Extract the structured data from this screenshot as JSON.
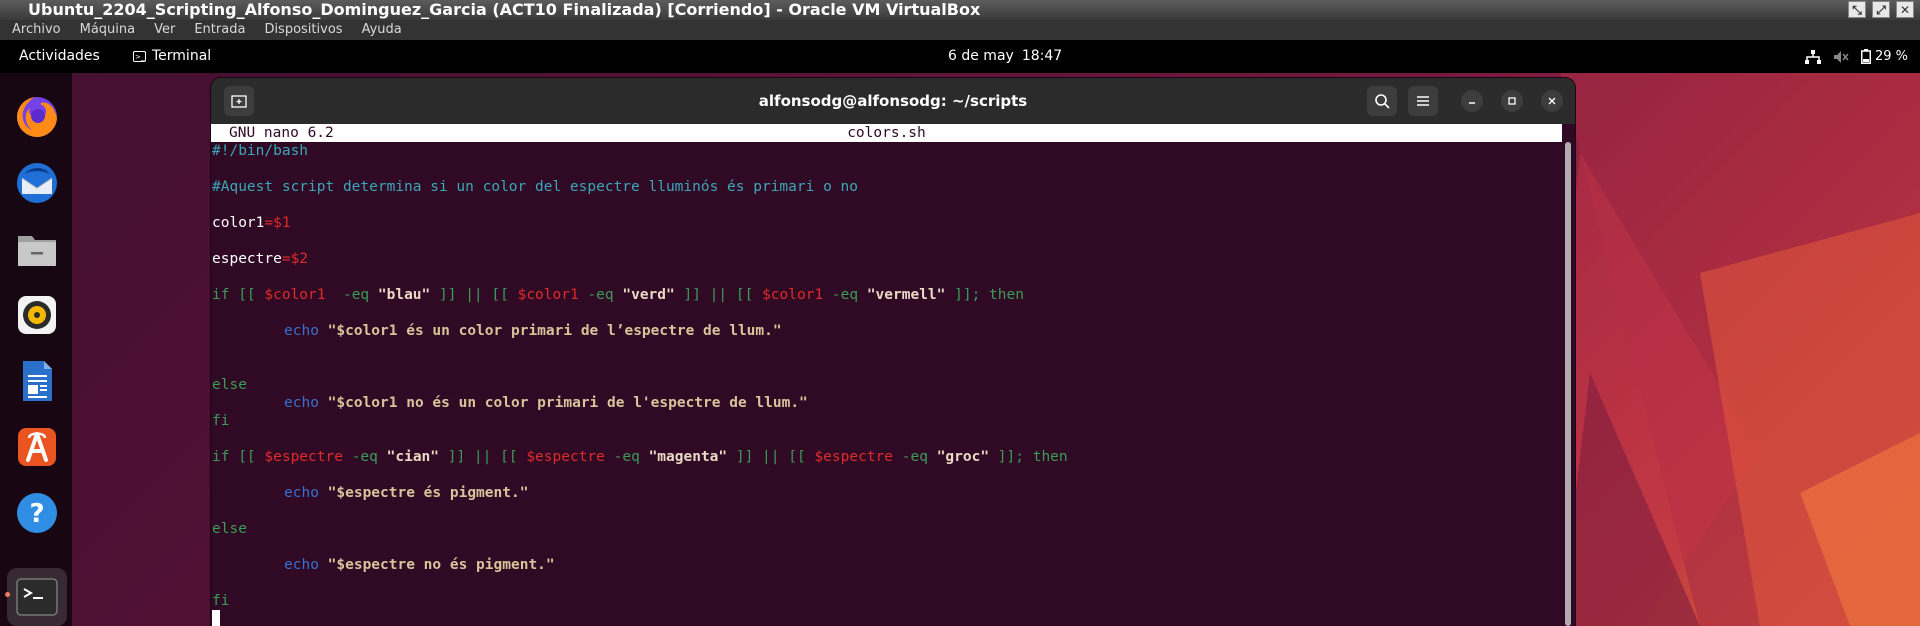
{
  "vbox": {
    "title": "Ubuntu_2204_Scripting_Alfonso_Dominguez_Garcia (ACT10 Finalizada) [Corriendo] - Oracle VM VirtualBox",
    "menu": [
      "Archivo",
      "Máquina",
      "Ver",
      "Entrada",
      "Dispositivos",
      "Ayuda"
    ]
  },
  "topbar": {
    "activities": "Actividades",
    "app": "Terminal",
    "date": "6 de may",
    "time": "18:47",
    "battery": "29 %"
  },
  "dock": {
    "items": [
      "firefox",
      "thunderbird",
      "files",
      "rhythmbox",
      "libreoffice-writer",
      "software-center",
      "help",
      "terminal"
    ]
  },
  "terminal": {
    "title": "alfonsodg@alfonsodg: ~/scripts",
    "nano_version": "GNU nano 6.2",
    "filename": "colors.sh"
  },
  "code": {
    "shebang": "#!/bin/bash",
    "comment": "#Aquest script determina si un color del espectre lluminós és primari o no",
    "l_color1_name": "color1",
    "l_color1_eq": "=",
    "l_color1_val": "$1",
    "l_espectre_name": "espectre",
    "l_espectre_eq": "=",
    "l_espectre_val": "$2",
    "if1": {
      "a": "if [[ ",
      "v1": "$color1",
      "b": "  -eq ",
      "s1": "\"blau\"",
      "c": " ]] || [[ ",
      "v2": "$color1",
      "d": " -eq ",
      "s2": "\"verd\"",
      "e": " ]] || [[ ",
      "v3": "$color1",
      "f": " -eq ",
      "s3": "\"vermell\"",
      "g": " ]]; then"
    },
    "echo1": {
      "kw": "echo",
      "str": "\"$color1 és un color primari de l’espectre de llum.\""
    },
    "else1": "else",
    "echo2": {
      "kw": "echo",
      "str": "\"$color1 no és un color primari de l'espectre de llum.\""
    },
    "fi1": "fi",
    "if2": {
      "a": "if [[ ",
      "v1": "$espectre",
      "b": " -eq ",
      "s1": "\"cian\"",
      "c": " ]] || [[ ",
      "v2": "$espectre",
      "d": " -eq ",
      "s2": "\"magenta\"",
      "e": " ]] || [[ ",
      "v3": "$espectre",
      "f": " -eq ",
      "s3": "\"groc\"",
      "g": " ]]; then"
    },
    "echo3": {
      "kw": "echo",
      "str": "\"$espectre és pigment.\""
    },
    "else2": "else",
    "echo4": {
      "kw": "echo",
      "str": "\"$espectre no és pigment.\""
    },
    "fi2": "fi"
  },
  "colors": {
    "terminal_bg": "#300a24",
    "accent": "#e95420"
  }
}
